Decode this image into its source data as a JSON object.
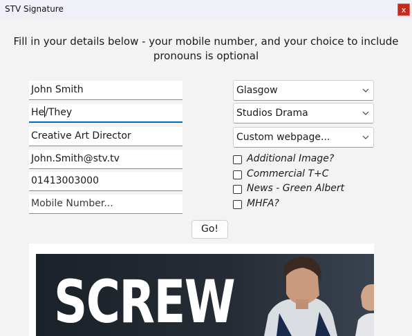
{
  "window": {
    "title": "STV Signature",
    "close_label": "x"
  },
  "instructions": "Fill in your details below - your mobile number, and your choice to include pronouns is optional",
  "fields": {
    "name": "John Smith",
    "pronouns_before_caret": "He",
    "pronouns_after_caret": "/They",
    "job_title": "Creative Art Director",
    "email": "John.Smith@stv.tv",
    "phone": "01413003000",
    "mobile_placeholder": "Mobile Number..."
  },
  "dropdowns": {
    "location": "Glasgow",
    "department": "Studios Drama",
    "webpage": "Custom webpage..."
  },
  "checkboxes": [
    {
      "label": "Additional Image?",
      "checked": false
    },
    {
      "label": "Commercial T+C",
      "checked": false
    },
    {
      "label": "News - Green Albert",
      "checked": false
    },
    {
      "label": "MHFA?",
      "checked": false
    }
  ],
  "go_button": "Go!",
  "preview": {
    "headline": "SCREW"
  }
}
